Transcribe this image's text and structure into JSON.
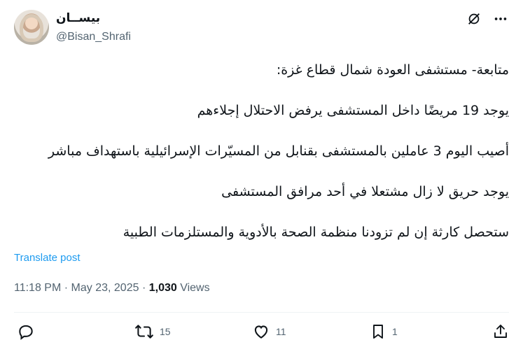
{
  "user": {
    "display_name": "بيســان",
    "handle": "@Bisan_Shrafi"
  },
  "post": {
    "lines": [
      "متابعة- مستشفى العودة شمال قطاع غزة:",
      "يوجد 19 مريضًا داخل المستشفى يرفض الاحتلال إجلاءهم",
      "أصيب اليوم 3 عاملين بالمستشفى بقنابل من المسيّرات الإسرائيلية باستهداف مباشر",
      "يوجد حريق لا زال مشتعلا في أحد مرافق المستشفى",
      "ستحصل كارثة إن لم تزودنا منظمة الصحة  بالأدوية والمستلزمات الطبية"
    ],
    "translate_label": "Translate post",
    "time": "11:18 PM",
    "date": "May 23, 2025",
    "separator": "·",
    "views_count": "1,030",
    "views_label": "Views"
  },
  "actions": {
    "reply_count": "",
    "repost_count": "15",
    "like_count": "11",
    "bookmark_count": "1"
  },
  "icons": {
    "grok": "grok-icon",
    "more": "more-icon",
    "reply": "reply-icon",
    "repost": "repost-icon",
    "like": "heart-icon",
    "bookmark": "bookmark-icon",
    "share": "share-icon"
  },
  "colors": {
    "text": "#0f1419",
    "secondary": "#536471",
    "link": "#1d9bf0"
  }
}
